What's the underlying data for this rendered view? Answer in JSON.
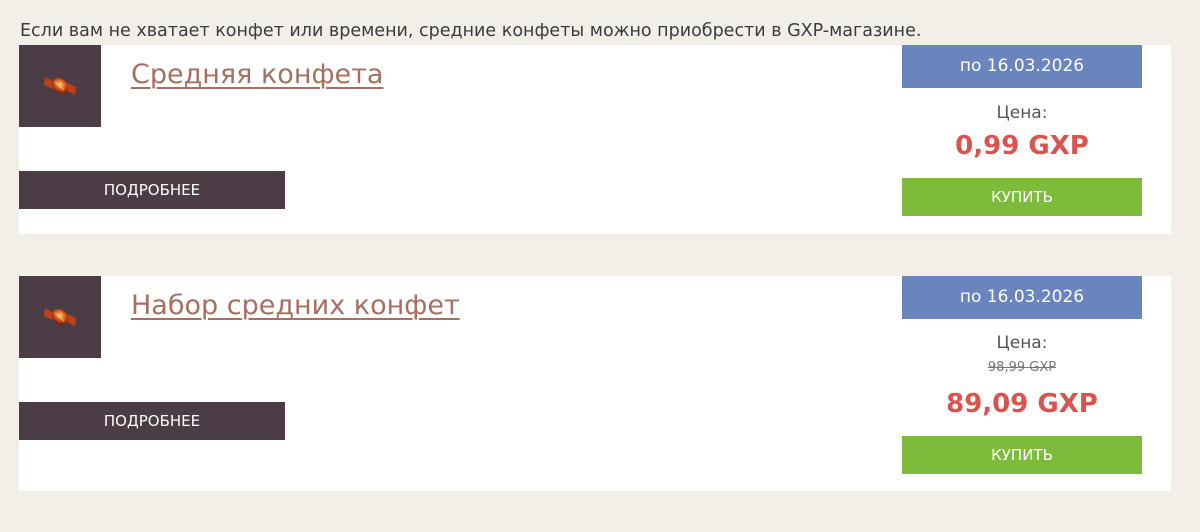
{
  "intro_text": "Если вам не хватает конфет или времени, средние конфеты можно приобрести в GXP-магазине.",
  "icon": "candy-icon",
  "colors": {
    "background": "#f2efe8",
    "card": "#ffffff",
    "dark_button": "#4b3c45",
    "date_badge": "#6a85be",
    "buy_button": "#7dbb3a",
    "price": "#d9534f",
    "title_link": "#a76f60"
  },
  "products": [
    {
      "title": "Средняя конфета",
      "details_label": "ПОДРОБНЕЕ",
      "date_label": "по 16.03.2026",
      "price_label": "Цена:",
      "price": "0,99 GXP",
      "buy_label": "КУПИТЬ"
    },
    {
      "title": "Набор средних конфет",
      "details_label": "ПОДРОБНЕЕ",
      "date_label": "по 16.03.2026",
      "price_label": "Цена:",
      "old_price": "98,99 GXP",
      "price": "89,09 GXP",
      "buy_label": "КУПИТЬ"
    }
  ]
}
